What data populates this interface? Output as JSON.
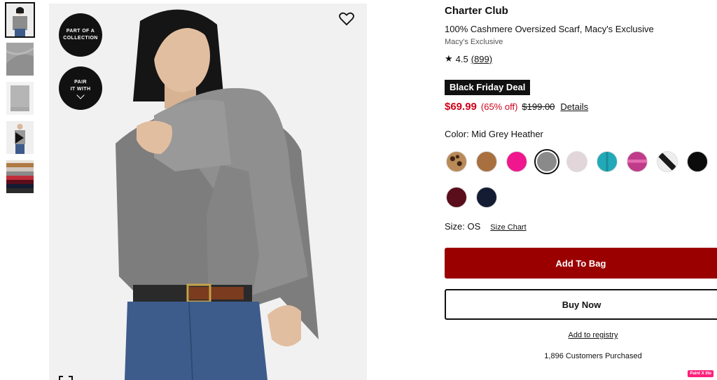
{
  "gallery": {
    "thumbnails": [
      {
        "name": "model-front",
        "active": true
      },
      {
        "name": "scarf-folded",
        "active": false
      },
      {
        "name": "scarf-flat",
        "active": false
      },
      {
        "name": "video",
        "active": false
      },
      {
        "name": "color-stack",
        "active": false
      }
    ],
    "badge_collection": [
      "PART OF A",
      "COLLECTION"
    ],
    "badge_pair": [
      "PAIR",
      "IT WITH"
    ],
    "icons": [
      "heart-icon",
      "chevron-down-icon",
      "play-icon",
      "expand-icon"
    ]
  },
  "product": {
    "brand": "Charter Club",
    "title": "100% Cashmere Oversized Scarf, Macy's Exclusive",
    "subtitle": "Macy's Exclusive",
    "rating_value": "4.5",
    "rating_count": "(899)",
    "deal_label": "Black Friday Deal",
    "price_now": "$69.99",
    "price_off": "(65% off)",
    "price_old": "$199.00",
    "details_link": "Details",
    "color_label": "Color: Mid Grey Heather",
    "size_label": "Size: OS",
    "size_chart_link": "Size Chart"
  },
  "swatches": [
    {
      "name": "leopard",
      "color": "#9a6a3a",
      "selected": false
    },
    {
      "name": "camel",
      "color": "#a8703f",
      "selected": false
    },
    {
      "name": "hot-pink",
      "color": "#f0168e",
      "selected": false
    },
    {
      "name": "mid-grey-heather",
      "color": "#8a8a8a",
      "selected": true
    },
    {
      "name": "blush",
      "color": "#e3d6da",
      "selected": false
    },
    {
      "name": "teal",
      "color": "#22a9b8",
      "selected": false
    },
    {
      "name": "magenta-stripe",
      "color": "#c03c8a",
      "selected": false
    },
    {
      "name": "black-white",
      "color": "#333333",
      "selected": false
    },
    {
      "name": "black",
      "color": "#0b0b0b",
      "selected": false
    },
    {
      "name": "burgundy",
      "color": "#5a0d1a",
      "selected": false
    },
    {
      "name": "navy",
      "color": "#141c33",
      "selected": false
    }
  ],
  "actions": {
    "add_to_bag": "Add To Bag",
    "buy_now": "Buy Now",
    "add_to_registry": "Add to registry",
    "customers_purchased": "1,896 Customers Purchased"
  },
  "colors": {
    "sale_red": "#d0021b",
    "bag_button": "#9b0000",
    "deal_bg": "#111111"
  },
  "overlay": {
    "paint_badge": "Paint X lite"
  }
}
